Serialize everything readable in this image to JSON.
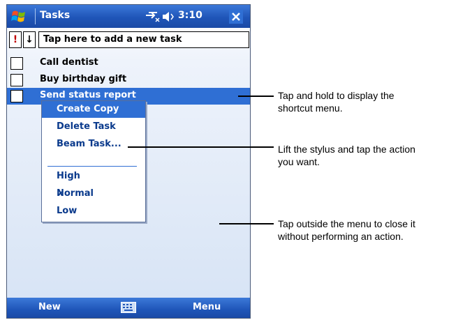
{
  "titlebar": {
    "title": "Tasks",
    "time": "3:10"
  },
  "add_row": {
    "priority_label": "!",
    "sort_label": "↓",
    "placeholder": "Tap here to add a new task"
  },
  "tasks": [
    {
      "label": "Call dentist",
      "checked": false
    },
    {
      "label": "Buy birthday gift",
      "checked": false
    },
    {
      "label": "Send status report",
      "checked": false,
      "selected": true
    }
  ],
  "context_menu": {
    "items": [
      "Create Copy",
      "Delete Task",
      "Beam Task..."
    ],
    "priority_items": [
      "High",
      "Normal",
      "Low"
    ],
    "checked_item": "Normal",
    "highlighted_item": "Create Copy"
  },
  "bottombar": {
    "new_label": "New",
    "menu_label": "Menu"
  },
  "callouts": [
    {
      "line1": "Tap and hold to display the",
      "line2": "shortcut menu."
    },
    {
      "line1": "Lift the stylus and tap the action",
      "line2": "you want."
    },
    {
      "line1": "Tap outside the menu to close it",
      "line2": "without performing an action."
    }
  ],
  "colors": {
    "bar_blue": "#1f55b8",
    "selection_blue": "#2f6fd4",
    "menu_text": "#0a3a8c"
  }
}
